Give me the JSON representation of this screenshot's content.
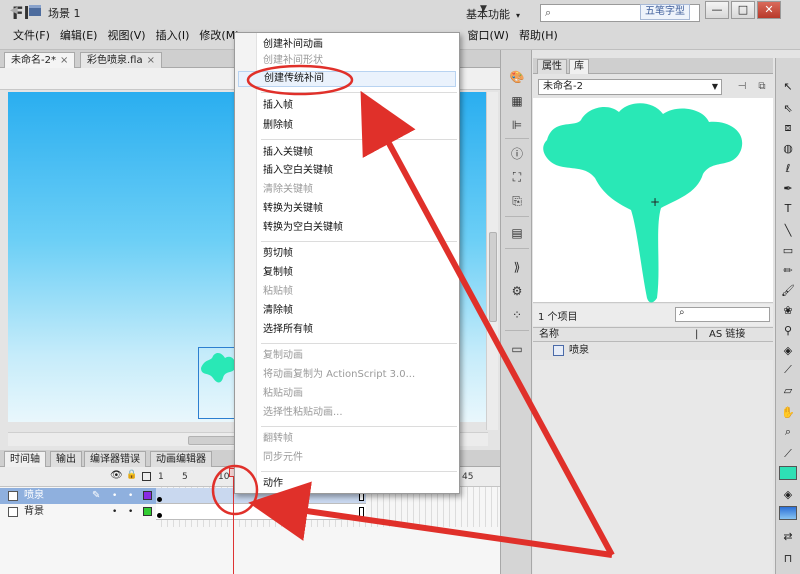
{
  "app": {
    "logo": "Fl",
    "workspace": "基本功能",
    "wubi": "五笔字型"
  },
  "menubar": [
    "文件(F)",
    "编辑(E)",
    "视图(V)",
    "插入(I)",
    "修改(M)",
    "窗口(W)",
    "帮助(H)"
  ],
  "window_buttons": [
    "—",
    "□",
    "✕"
  ],
  "doc_tabs": [
    {
      "label": "未命名-2*",
      "close": "×"
    },
    {
      "label": "彩色喷泉.fla",
      "close": "×"
    }
  ],
  "breadcrumb": {
    "back": "◀",
    "scene": "场景 1"
  },
  "timeline": {
    "tabs": [
      "时间轴",
      "输出",
      "编译器错误",
      "动画编辑器"
    ],
    "ruler": [
      "1",
      "5",
      "10",
      "45"
    ],
    "layers": [
      {
        "name": "喷泉",
        "color": "#8a2be2"
      },
      {
        "name": "背景",
        "color": "#33cc33"
      }
    ]
  },
  "context_menu": {
    "items": [
      {
        "label": "创建补间动画",
        "disabled": false
      },
      {
        "label": "创建补间形状",
        "disabled": true
      },
      {
        "label": "创建传统补间",
        "disabled": false,
        "highlight": true
      },
      {
        "label": "插入帧",
        "disabled": false
      },
      {
        "label": "删除帧",
        "disabled": false
      },
      {
        "label": "插入关键帧",
        "disabled": false
      },
      {
        "label": "插入空白关键帧",
        "disabled": false
      },
      {
        "label": "清除关键帧",
        "disabled": true
      },
      {
        "label": "转换为关键帧",
        "disabled": false
      },
      {
        "label": "转换为空白关键帧",
        "disabled": false
      },
      {
        "label": "剪切帧",
        "disabled": false
      },
      {
        "label": "复制帧",
        "disabled": false
      },
      {
        "label": "粘贴帧",
        "disabled": true
      },
      {
        "label": "清除帧",
        "disabled": false
      },
      {
        "label": "选择所有帧",
        "disabled": false
      },
      {
        "label": "复制动画",
        "disabled": true
      },
      {
        "label": "将动画复制为 ActionScript 3.0...",
        "disabled": true
      },
      {
        "label": "粘贴动画",
        "disabled": true
      },
      {
        "label": "选择性粘贴动画...",
        "disabled": true
      },
      {
        "label": "翻转帧",
        "disabled": true
      },
      {
        "label": "同步元件",
        "disabled": true
      },
      {
        "label": "动作",
        "disabled": false
      }
    ]
  },
  "library": {
    "tabs": [
      "属性",
      "库"
    ],
    "document": "未命名-2",
    "count": "1 个项目",
    "columns": [
      "名称",
      "AS 链接"
    ],
    "items": [
      {
        "name": "喷泉"
      }
    ],
    "shape_color": "#29e8b6"
  },
  "colors": {
    "accent_annotation": "#e0302a",
    "fill_swatch": "#2ee0b5",
    "stroke_swatch": "#2b6fd6"
  }
}
